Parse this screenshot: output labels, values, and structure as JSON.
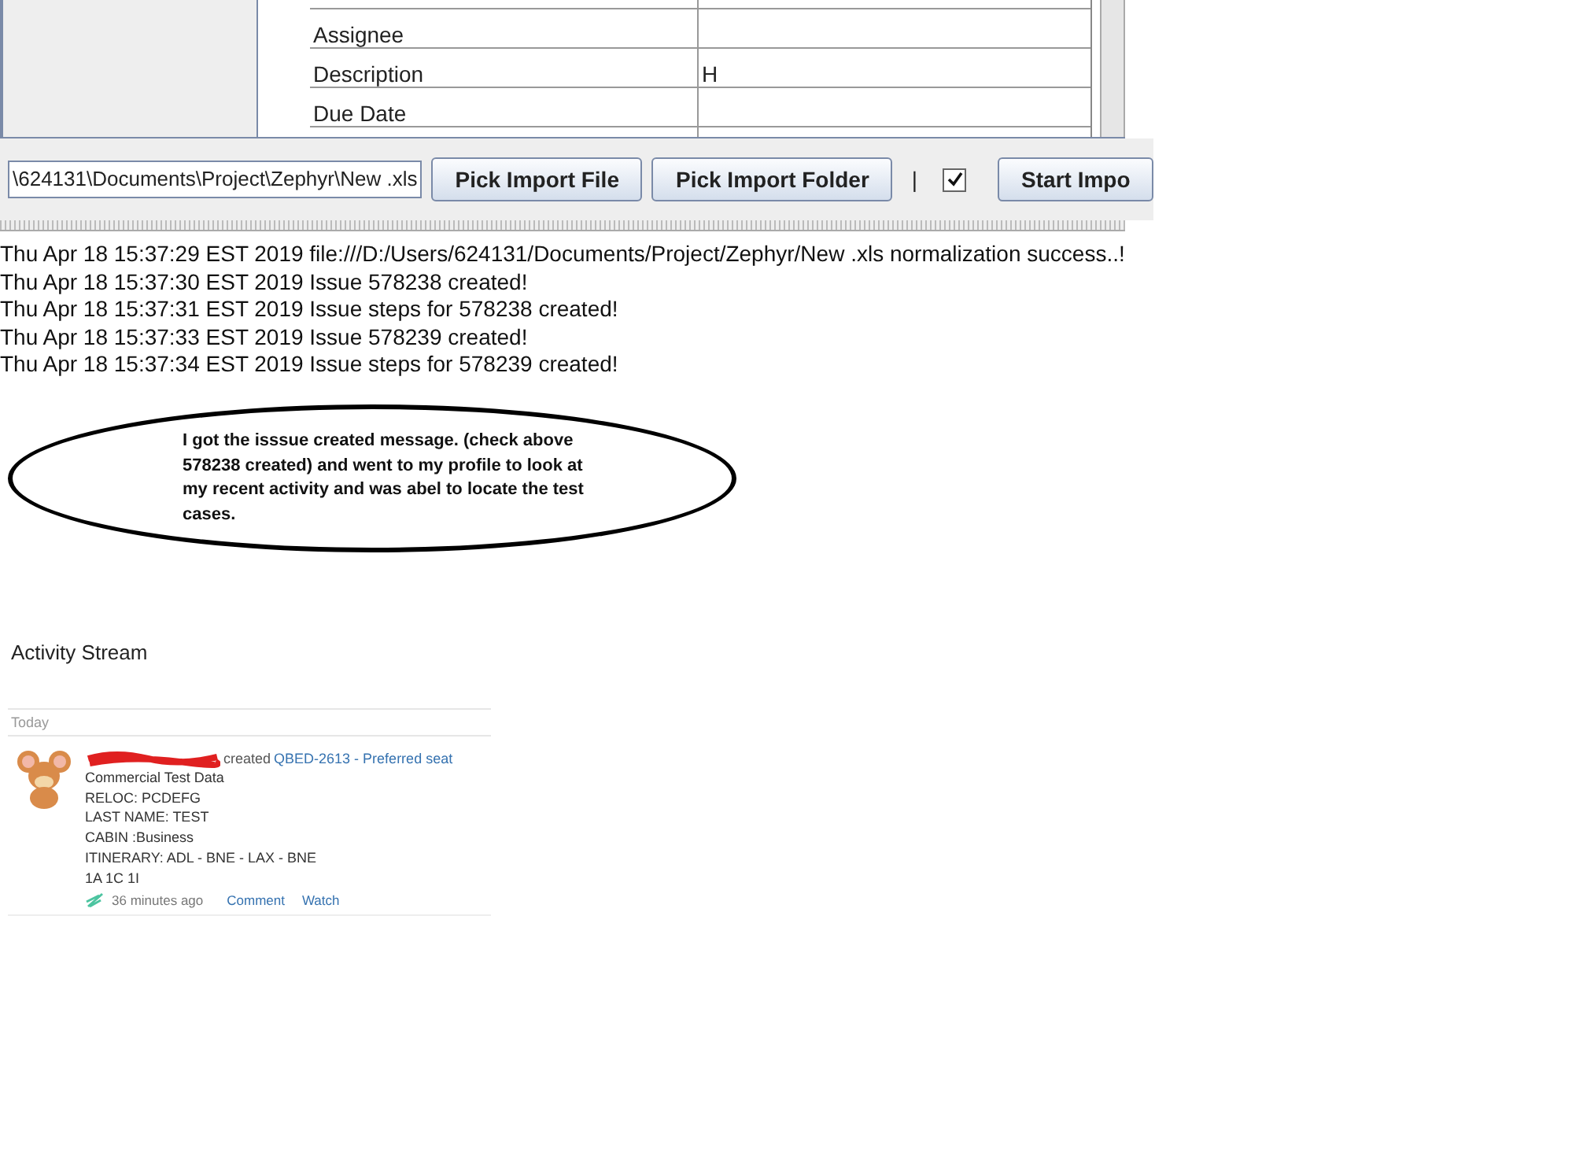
{
  "form_table": {
    "rows": [
      {
        "label": "Assignee"
      },
      {
        "label": "Description",
        "value": "H"
      },
      {
        "label": "Due Date"
      }
    ]
  },
  "toolbar": {
    "path_value": "\\624131\\Documents\\Project\\Zephyr\\New .xls",
    "buttons": [
      "Pick Import File",
      "Pick Import Folder"
    ],
    "separator": "|",
    "checkbox": {
      "checked": true
    },
    "start_button": "Start Impo"
  },
  "log": [
    "Thu Apr 18 15:37:29 EST 2019 file:///D:/Users/624131/Documents/Project/Zephyr/New .xls normalization success..!",
    "Thu Apr 18 15:37:30 EST 2019 Issue 578238 created!",
    "Thu Apr 18 15:37:31 EST 2019 Issue steps for 578238 created!",
    "Thu Apr 18 15:37:33 EST 2019 Issue 578239 created!",
    "Thu Apr 18 15:37:34 EST 2019 Issue steps for 578239 created!"
  ],
  "annotation": "I got the isssue created message. (check above 578238 created) and went to my profile to look at my recent activity and was abel to locate the test cases.",
  "activity": {
    "title": "Activity Stream",
    "group": "Today",
    "entries": [
      {
        "action": "created",
        "link": "QBED-2613 - Preferred seat",
        "details": [
          "Commercial Test Data",
          "RELOC: PCDEFG",
          "LAST NAME: TEST",
          "CABIN :Business",
          "ITINERARY: ADL - BNE - LAX - BNE",
          "1A 1C 1I"
        ],
        "time": "36 minutes ago",
        "actions": [
          "Comment",
          "Watch"
        ]
      }
    ]
  }
}
